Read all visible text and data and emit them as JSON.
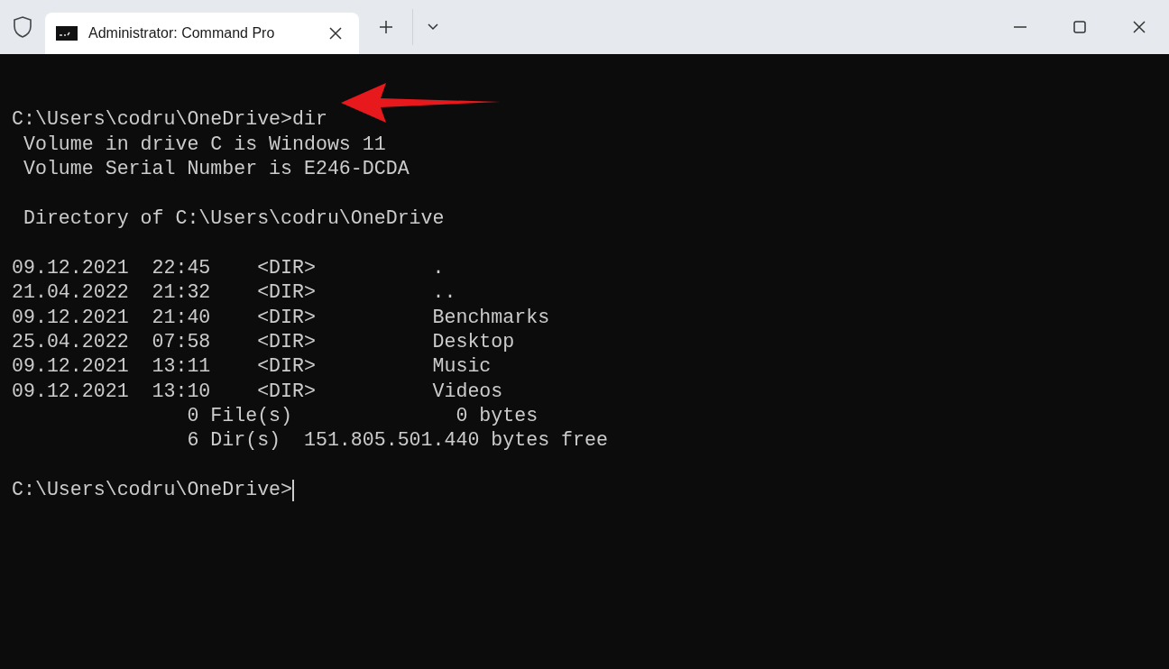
{
  "window": {
    "tab": {
      "title": "Administrator: Command Pro",
      "selected": true
    }
  },
  "terminal": {
    "blocks": [
      [
        "C:\\Users\\codru\\OneDrive>dir",
        " Volume in drive C is Windows 11",
        " Volume Serial Number is E246-DCDA"
      ],
      [
        " Directory of C:\\Users\\codru\\OneDrive"
      ],
      [
        "09.12.2021  22:45    <DIR>          .",
        "21.04.2022  21:32    <DIR>          ..",
        "09.12.2021  21:40    <DIR>          Benchmarks",
        "25.04.2022  07:58    <DIR>          Desktop",
        "09.12.2021  13:11    <DIR>          Music",
        "09.12.2021  13:10    <DIR>          Videos",
        "               0 File(s)              0 bytes",
        "               6 Dir(s)  151.805.501.440 bytes free"
      ],
      [
        "C:\\Users\\codru\\OneDrive>"
      ]
    ],
    "cursor": true
  }
}
